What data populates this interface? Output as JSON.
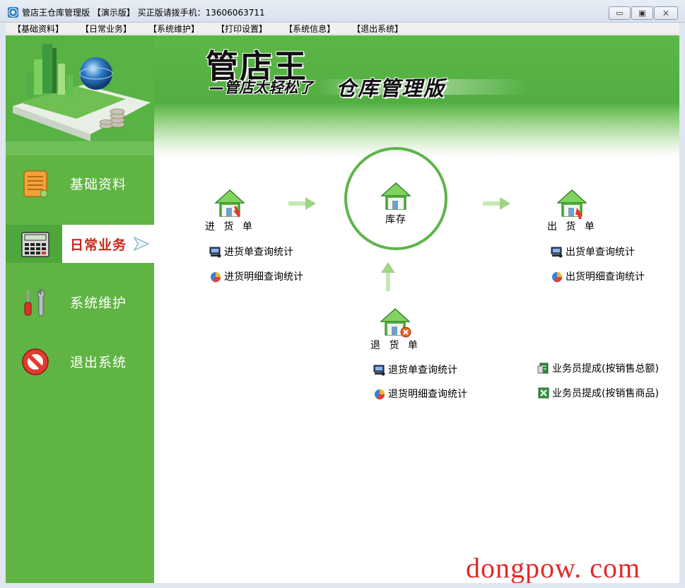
{
  "window": {
    "title": "管店王仓库管理版 【演示版】 买正版请拨手机：13606063711",
    "minimize_label": "▭",
    "maximize_label": "▣",
    "close_label": "✕"
  },
  "menu": [
    "【基础资料】",
    "【日常业务】",
    "【系统维护】",
    "【打印设置】",
    "【系统信息】",
    "【退出系统】"
  ],
  "banner": {
    "brand": "管店王",
    "slogan": "—管店太轻松了",
    "edition": "仓库管理版"
  },
  "sidebar": {
    "items": [
      {
        "label": "基础资料",
        "icon": "ledger-icon",
        "active": false
      },
      {
        "label": "日常业务",
        "icon": "calculator-icon",
        "active": true
      },
      {
        "label": "系统维护",
        "icon": "tools-icon",
        "active": false
      },
      {
        "label": "退出系统",
        "icon": "stop-icon",
        "active": false
      }
    ]
  },
  "flow": {
    "purchase": {
      "label": "进 货 单"
    },
    "inventory": {
      "label": "库存"
    },
    "sales": {
      "label": "出 货 单"
    },
    "returns": {
      "label": "退 货 单"
    }
  },
  "links": {
    "purchase_query": "进货单查询统计",
    "purchase_detail": "进货明细查询统计",
    "sales_query": "出货单查询统计",
    "sales_detail": "出货明细查询统计",
    "returns_query": "退货单查询统计",
    "returns_detail": "退货明细查询统计",
    "commission_total": "业务员提成(按销售总额)",
    "commission_product": "业务员提成(按销售商品)"
  },
  "watermark": "dongpow. com",
  "colors": {
    "sidebar_green": "#5fb443",
    "active_text": "#c8261a",
    "ring_green": "#5db54a",
    "watermark_red": "#e02b2b"
  }
}
